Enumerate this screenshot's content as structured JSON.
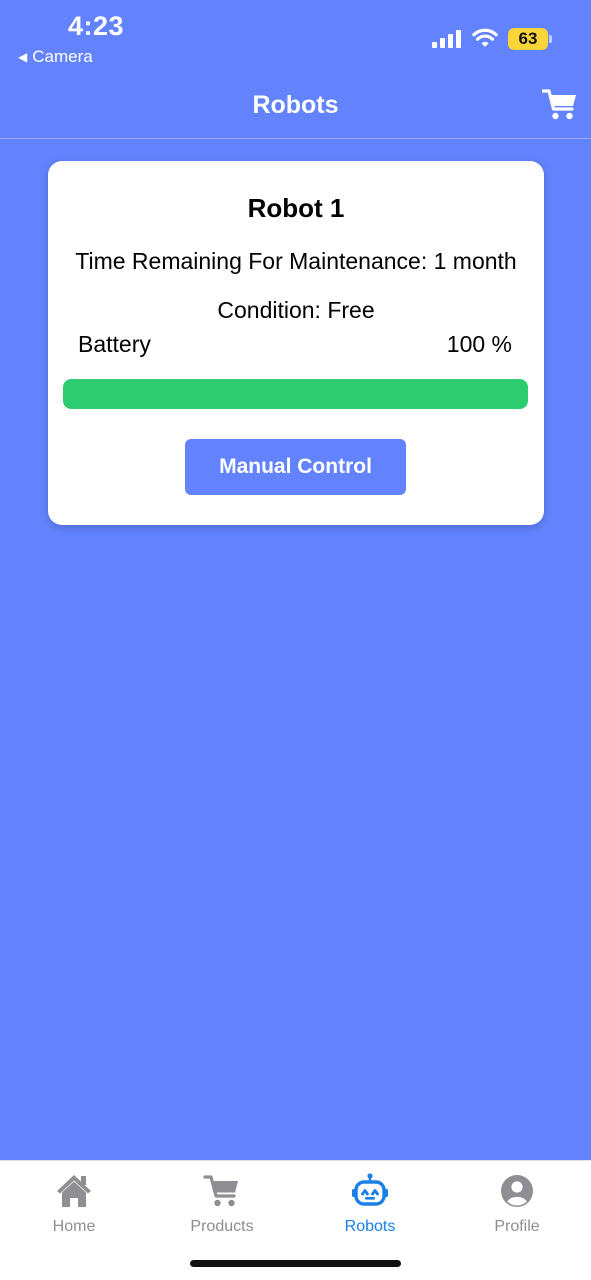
{
  "status_bar": {
    "time": "4:23",
    "back_app": "Camera",
    "battery_level": "63"
  },
  "header": {
    "title": "Robots",
    "cart_icon": "cart-icon"
  },
  "robot_card": {
    "name": "Robot 1",
    "maintenance": "Time Remaining For Maintenance: 1 month",
    "condition": "Condition: Free",
    "battery_label": "Battery",
    "battery_value": "100 %",
    "battery_fraction": 1.0,
    "battery_color": "#2ecc71",
    "button_label": "Manual Control"
  },
  "tabs": [
    {
      "label": "Home",
      "icon": "home-icon",
      "active": false
    },
    {
      "label": "Products",
      "icon": "cart-icon",
      "active": false
    },
    {
      "label": "Robots",
      "icon": "robot-icon",
      "active": true
    },
    {
      "label": "Profile",
      "icon": "user-circle-icon",
      "active": false
    }
  ],
  "colors": {
    "background": "#6383fe",
    "accent": "#1a80e6",
    "inactive_tab": "#8e8e93",
    "battery_badge": "#f9d53a"
  }
}
